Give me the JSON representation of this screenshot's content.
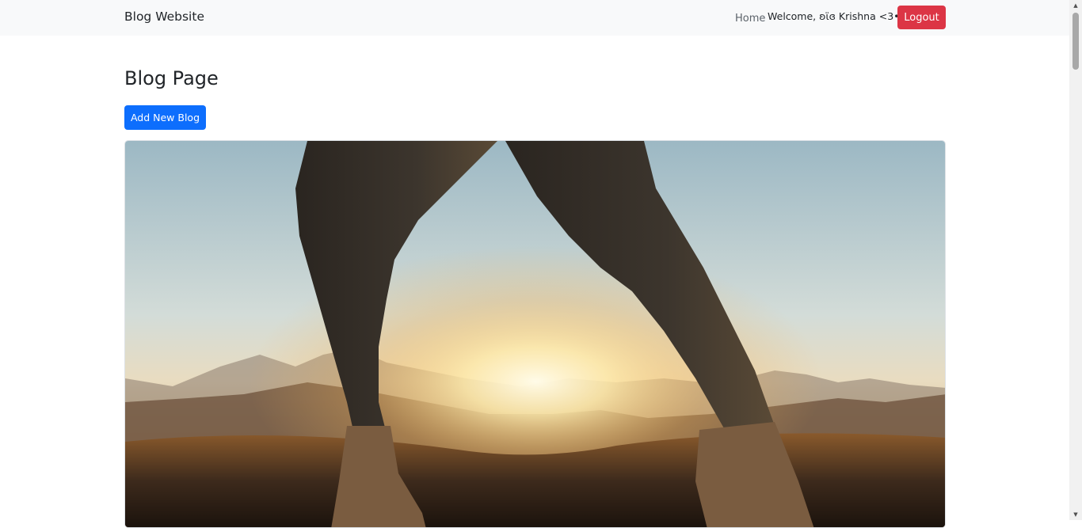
{
  "navbar": {
    "brand": "Blog Website",
    "home_link": "Home",
    "welcome_text": "Welcome, ʚϊɞ Krishna <3•°✧!",
    "logout_label": "Logout"
  },
  "main": {
    "title": "Blog Page",
    "add_button_label": "Add New Blog"
  },
  "colors": {
    "navbar_bg": "#f8f9fa",
    "primary": "#0d6efd",
    "danger": "#dc3545"
  },
  "icons": {
    "scroll_up": "scroll-up-arrow-icon",
    "scroll_down": "scroll-down-arrow-icon"
  }
}
